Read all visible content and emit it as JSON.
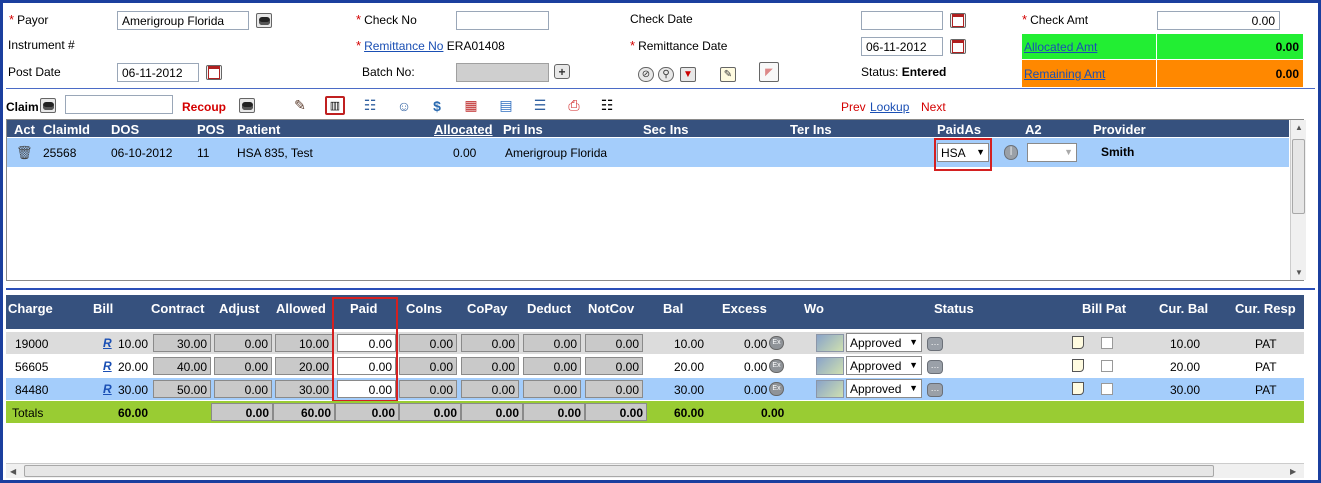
{
  "form": {
    "payor_label": "Payor",
    "payor_value": "Amerigroup Florida",
    "instrument_label": "Instrument #",
    "post_date_label": "Post Date",
    "post_date_value": "06-11-2012",
    "check_no_label": "Check No",
    "check_no_value": "",
    "remittance_no_label": "Remittance No",
    "remittance_no_value": "ERA01408",
    "batch_no_label": "Batch No:",
    "check_date_label": "Check Date",
    "check_date_value": "",
    "remittance_date_label": "Remittance Date",
    "remittance_date_value": "06-11-2012",
    "status_label": "Status:",
    "status_value": "Entered",
    "check_amt_label": "Check Amt",
    "check_amt_value": "0.00",
    "allocated_amt_label": "Allocated Amt",
    "allocated_amt_value": "0.00",
    "remaining_amt_label": "Remaining Amt",
    "remaining_amt_value": "0.00"
  },
  "colors": {
    "allocated": "#22ee33",
    "remaining": "#ff8800",
    "header": "#36517e",
    "selected_row": "#a4cdfb",
    "totals": "#99cc33"
  },
  "toolbar": {
    "claim_label": "Claim",
    "claim_value": "",
    "recoup_label": "Recoup",
    "prev_label": "Prev",
    "lookup_label": "Lookup",
    "next_label": "Next"
  },
  "claims": {
    "headers": [
      "Act",
      "ClaimId",
      "DOS",
      "POS",
      "Patient",
      "Allocated",
      "Pri Ins",
      "Sec Ins",
      "Ter Ins",
      "PaidAs",
      "A2",
      "Provider"
    ],
    "rows": [
      {
        "claim_id": "25568",
        "dos": "06-10-2012",
        "pos": "11",
        "patient": "HSA 835, Test",
        "allocated": "0.00",
        "pri_ins": "Amerigroup Florida",
        "sec_ins": "",
        "ter_ins": "",
        "paid_as": "HSA",
        "a2": "",
        "provider": "Smith"
      }
    ]
  },
  "charges": {
    "headers": [
      "Charge",
      "Bill",
      "Contract",
      "Adjust",
      "Allowed",
      "Paid",
      "CoIns",
      "CoPay",
      "Deduct",
      "NotCov",
      "Bal",
      "Excess",
      "Wo",
      "Status",
      "Bill Pat",
      "Cur. Bal",
      "Cur. Resp"
    ],
    "rows": [
      {
        "charge": "19000",
        "bill_link": "R",
        "bill": "10.00",
        "contract": "30.00",
        "adjust": "0.00",
        "allowed": "10.00",
        "paid": "0.00",
        "coins": "0.00",
        "copay": "0.00",
        "deduct": "0.00",
        "notcov": "0.00",
        "bal": "10.00",
        "excess": "0.00",
        "status": "Approved",
        "cur_bal": "10.00",
        "cur_resp": "PAT"
      },
      {
        "charge": "56605",
        "bill_link": "R",
        "bill": "20.00",
        "contract": "40.00",
        "adjust": "0.00",
        "allowed": "20.00",
        "paid": "0.00",
        "coins": "0.00",
        "copay": "0.00",
        "deduct": "0.00",
        "notcov": "0.00",
        "bal": "20.00",
        "excess": "0.00",
        "status": "Approved",
        "cur_bal": "20.00",
        "cur_resp": "PAT"
      },
      {
        "charge": "84480",
        "bill_link": "R",
        "bill": "30.00",
        "contract": "50.00",
        "adjust": "0.00",
        "allowed": "30.00",
        "paid": "0.00",
        "coins": "0.00",
        "copay": "0.00",
        "deduct": "0.00",
        "notcov": "0.00",
        "bal": "30.00",
        "excess": "0.00",
        "status": "Approved",
        "cur_bal": "30.00",
        "cur_resp": "PAT"
      }
    ],
    "totals": {
      "label": "Totals",
      "bill": "60.00",
      "adjust": "0.00",
      "allowed": "60.00",
      "paid": "0.00",
      "coins": "0.00",
      "copay": "0.00",
      "deduct": "0.00",
      "notcov": "0.00",
      "bal": "60.00",
      "excess": "0.00"
    }
  }
}
